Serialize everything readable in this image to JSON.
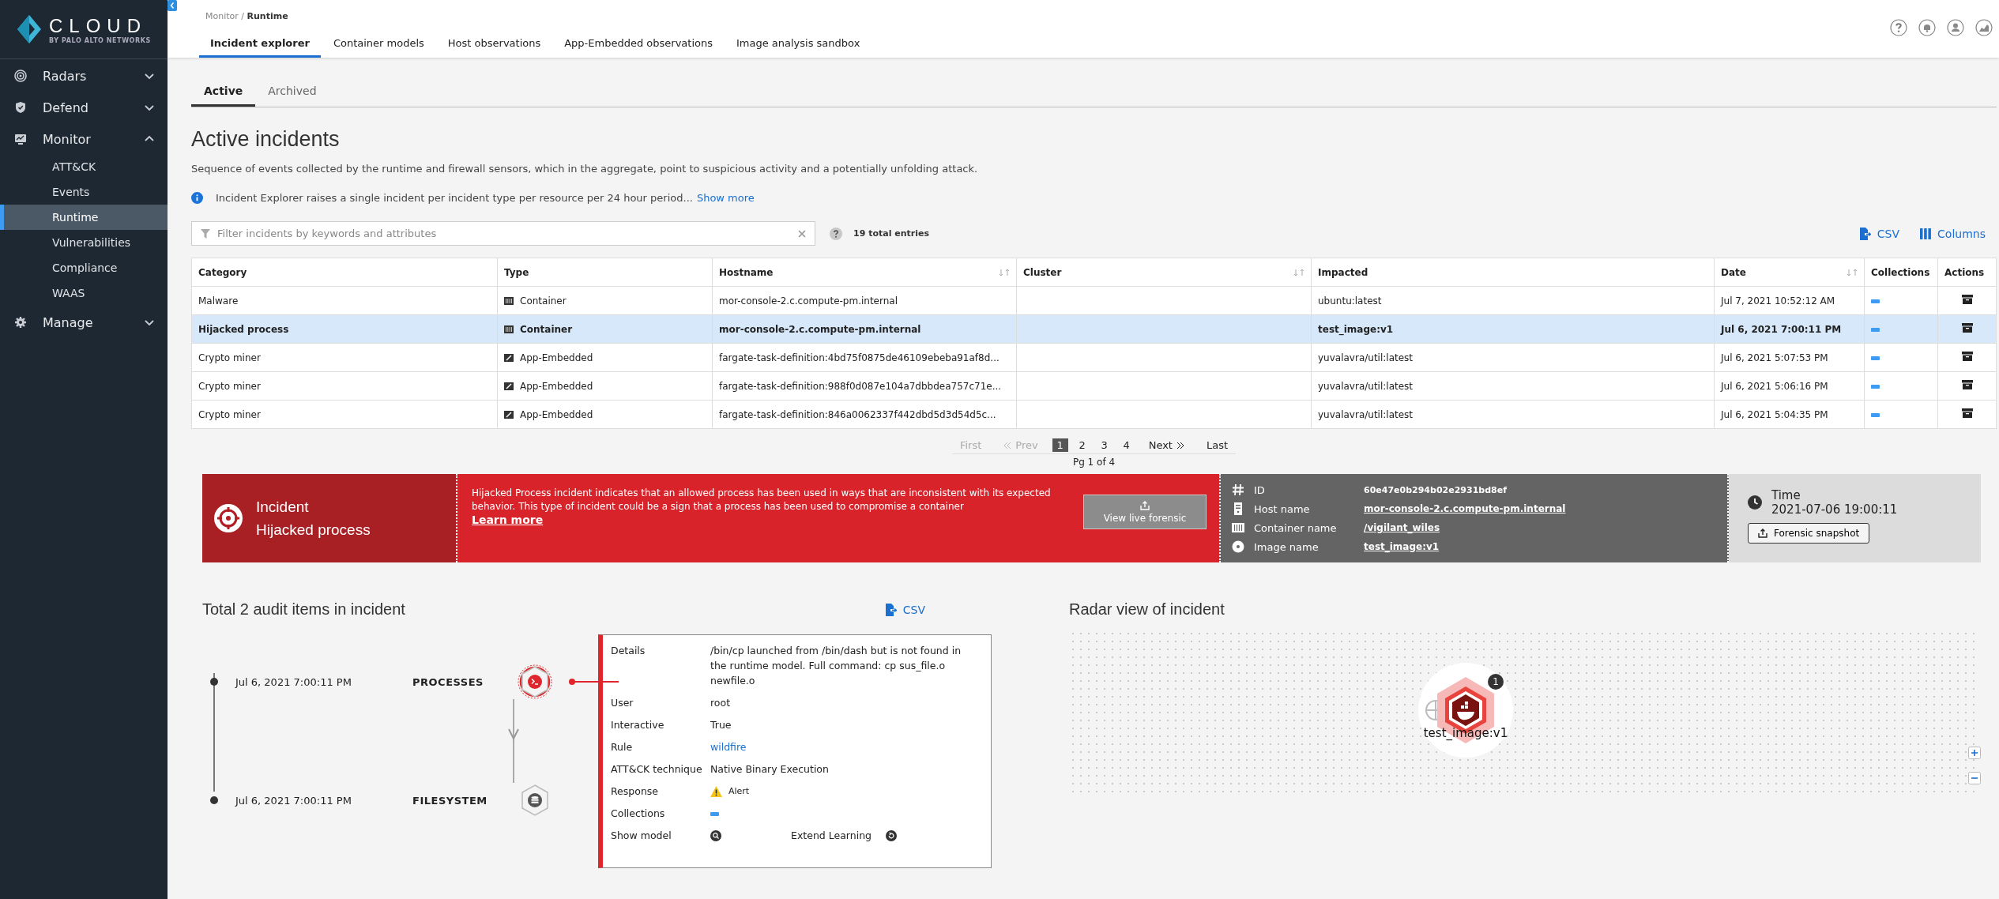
{
  "sidebar": {
    "logo": {
      "title": "CLOUD",
      "subtitle": "BY PALO ALTO NETWORKS"
    },
    "items": [
      {
        "label": "Radars",
        "kind": "radar",
        "expanded": false
      },
      {
        "label": "Defend",
        "kind": "shield",
        "expanded": false
      },
      {
        "label": "Monitor",
        "kind": "monitor",
        "expanded": true,
        "children": [
          {
            "label": "ATT&CK",
            "selected": false
          },
          {
            "label": "Events",
            "selected": false
          },
          {
            "label": "Runtime",
            "selected": true
          },
          {
            "label": "Vulnerabilities",
            "selected": false
          },
          {
            "label": "Compliance",
            "selected": false
          },
          {
            "label": "WAAS",
            "selected": false
          }
        ]
      },
      {
        "label": "Manage",
        "kind": "gear",
        "expanded": false
      }
    ]
  },
  "breadcrumb": "Monitor / **Runtime**",
  "tabs": [
    {
      "label": "Incident explorer",
      "selected": true
    },
    {
      "label": "Container models",
      "selected": false
    },
    {
      "label": "Host observations",
      "selected": false
    },
    {
      "label": "App-Embedded observations",
      "selected": false
    },
    {
      "label": "Image analysis sandbox",
      "selected": false
    }
  ],
  "subtabs": [
    {
      "label": "Active",
      "selected": true
    },
    {
      "label": "Archived",
      "selected": false
    }
  ],
  "title": "Active incidents",
  "description": "Sequence of events collected by the runtime and firewall sensors, which in the aggregate, point to suspicious activity and a potentially unfolding attack.",
  "notice": {
    "text": "Incident Explorer raises a single incident per incident type per resource per 24 hour period...",
    "link": "Show more"
  },
  "filter": {
    "placeholder": "Filter incidents by keywords and attributes"
  },
  "total_entries": "19 total entries",
  "toolbar": [
    {
      "label": "CSV",
      "kind": "csv"
    },
    {
      "label": "Columns",
      "kind": "columns"
    }
  ],
  "table": {
    "columns": [
      {
        "label": "Category",
        "sortable": false
      },
      {
        "label": "Type",
        "sortable": false
      },
      {
        "label": "Hostname",
        "sortable": true
      },
      {
        "label": "Cluster",
        "sortable": true
      },
      {
        "label": "Impacted",
        "sortable": false
      },
      {
        "label": "Date",
        "sortable": true
      },
      {
        "label": "Collections",
        "sortable": false
      },
      {
        "label": "Actions",
        "sortable": false
      }
    ],
    "rows": [
      {
        "selected": false,
        "kind": "container",
        "category": "Malware",
        "type": "Container",
        "hostname": "mor-console-2.c.compute-pm.internal",
        "impacted": "ubuntu:latest",
        "date": "Jul 7, 2021 10:52:12 AM",
        "color": "#3d9bf2"
      },
      {
        "selected": true,
        "kind": "container",
        "category": "Hijacked process",
        "type": "Container",
        "hostname": "mor-console-2.c.compute-pm.internal",
        "impacted": "test_image:v1",
        "date": "Jul 6, 2021 7:00:11 PM",
        "color": "#3d9bf2"
      },
      {
        "selected": false,
        "kind": "app",
        "category": "Crypto miner",
        "type": "App-Embedded",
        "hostname": "fargate-task-definition:4bd75f0875de46109ebeba91af8d...",
        "impacted": "yuvalavra/util:latest",
        "date": "Jul 6, 2021 5:07:53 PM",
        "color": "#3d9bf2"
      },
      {
        "selected": false,
        "kind": "app",
        "category": "Crypto miner",
        "type": "App-Embedded",
        "hostname": "fargate-task-definition:988f0d087e104a7dbbdea757c71e...",
        "impacted": "yuvalavra/util:latest",
        "date": "Jul 6, 2021 5:06:16 PM",
        "color": "#3d9bf2"
      },
      {
        "selected": false,
        "kind": "app",
        "category": "Crypto miner",
        "type": "App-Embedded",
        "hostname": "fargate-task-definition:846a0062337f442dbd5d3d54d5c...",
        "impacted": "yuvalavra/util:latest",
        "date": "Jul 6, 2021 5:04:35 PM",
        "color": "#3d9bf2"
      }
    ]
  },
  "pagination": {
    "first": {
      "label": "First",
      "disabled": true
    },
    "prev": {
      "label": "Prev",
      "disabled": true
    },
    "pages": [
      {
        "label": "1",
        "selected": true
      },
      {
        "label": "2",
        "selected": false
      },
      {
        "label": "3",
        "selected": false
      },
      {
        "label": "4",
        "selected": false
      }
    ],
    "next": {
      "label": "Next",
      "disabled": false
    },
    "last": {
      "label": "Last",
      "disabled": false
    },
    "summary": "Pg 1 of 4"
  },
  "incident": {
    "label": "Incident",
    "category": "Hijacked process",
    "description": "Hijacked Process incident indicates that an allowed process has been used in ways that are inconsistent with its expected behavior. This type of incident could be a sign that a process has been used to compromise a container",
    "learn_more": "Learn more",
    "forensic_button": "View live forensic",
    "fields": [
      {
        "kind": "hash",
        "label": "ID",
        "value": "60e47e0b294b02e2931bd8ef",
        "link": false
      },
      {
        "kind": "server",
        "label": "Host name",
        "value": "mor-console-2.c.compute-pm.internal",
        "link": true
      },
      {
        "kind": "container",
        "label": "Container name",
        "value": "/vigilant_wiles",
        "link": true
      },
      {
        "kind": "disc",
        "label": "Image name",
        "value": "test_image:v1",
        "link": true
      }
    ],
    "time": {
      "label": "Time",
      "value": "2021-07-06 19:00:11"
    },
    "snapshot_button": "Forensic snapshot"
  },
  "audit": {
    "title": "Total 2 audit items in incident",
    "csv": "CSV",
    "events": [
      {
        "kind": "terminal",
        "time": "Jul 6, 2021 7:00:11 PM",
        "type": "PROCESSES",
        "selected": true
      },
      {
        "kind": "database",
        "time": "Jul 6, 2021 7:00:11 PM",
        "type": "FILESYSTEM",
        "selected": false
      }
    ],
    "details": [
      {
        "kind": "text",
        "label": "Details",
        "value": "/bin/cp launched from /bin/dash but is not found in the runtime model. Full command: cp sus_file.o newfile.o"
      },
      {
        "kind": "text",
        "label": "User",
        "value": "root"
      },
      {
        "kind": "text",
        "label": "Interactive",
        "value": "True"
      },
      {
        "kind": "link",
        "label": "Rule",
        "value": "wildfire"
      },
      {
        "kind": "text",
        "label": "ATT&CK technique",
        "value": "Native Binary Execution"
      },
      {
        "kind": "alert",
        "label": "Response",
        "value": "Alert"
      },
      {
        "kind": "collection",
        "label": "Collections",
        "color": "#3d9bf2"
      },
      {
        "kind": "actions",
        "label": "Show model",
        "action_label": "Extend Learning"
      }
    ]
  },
  "radar": {
    "title": "Radar view of incident",
    "node": {
      "label": "test_image:v1",
      "count": "1"
    }
  }
}
